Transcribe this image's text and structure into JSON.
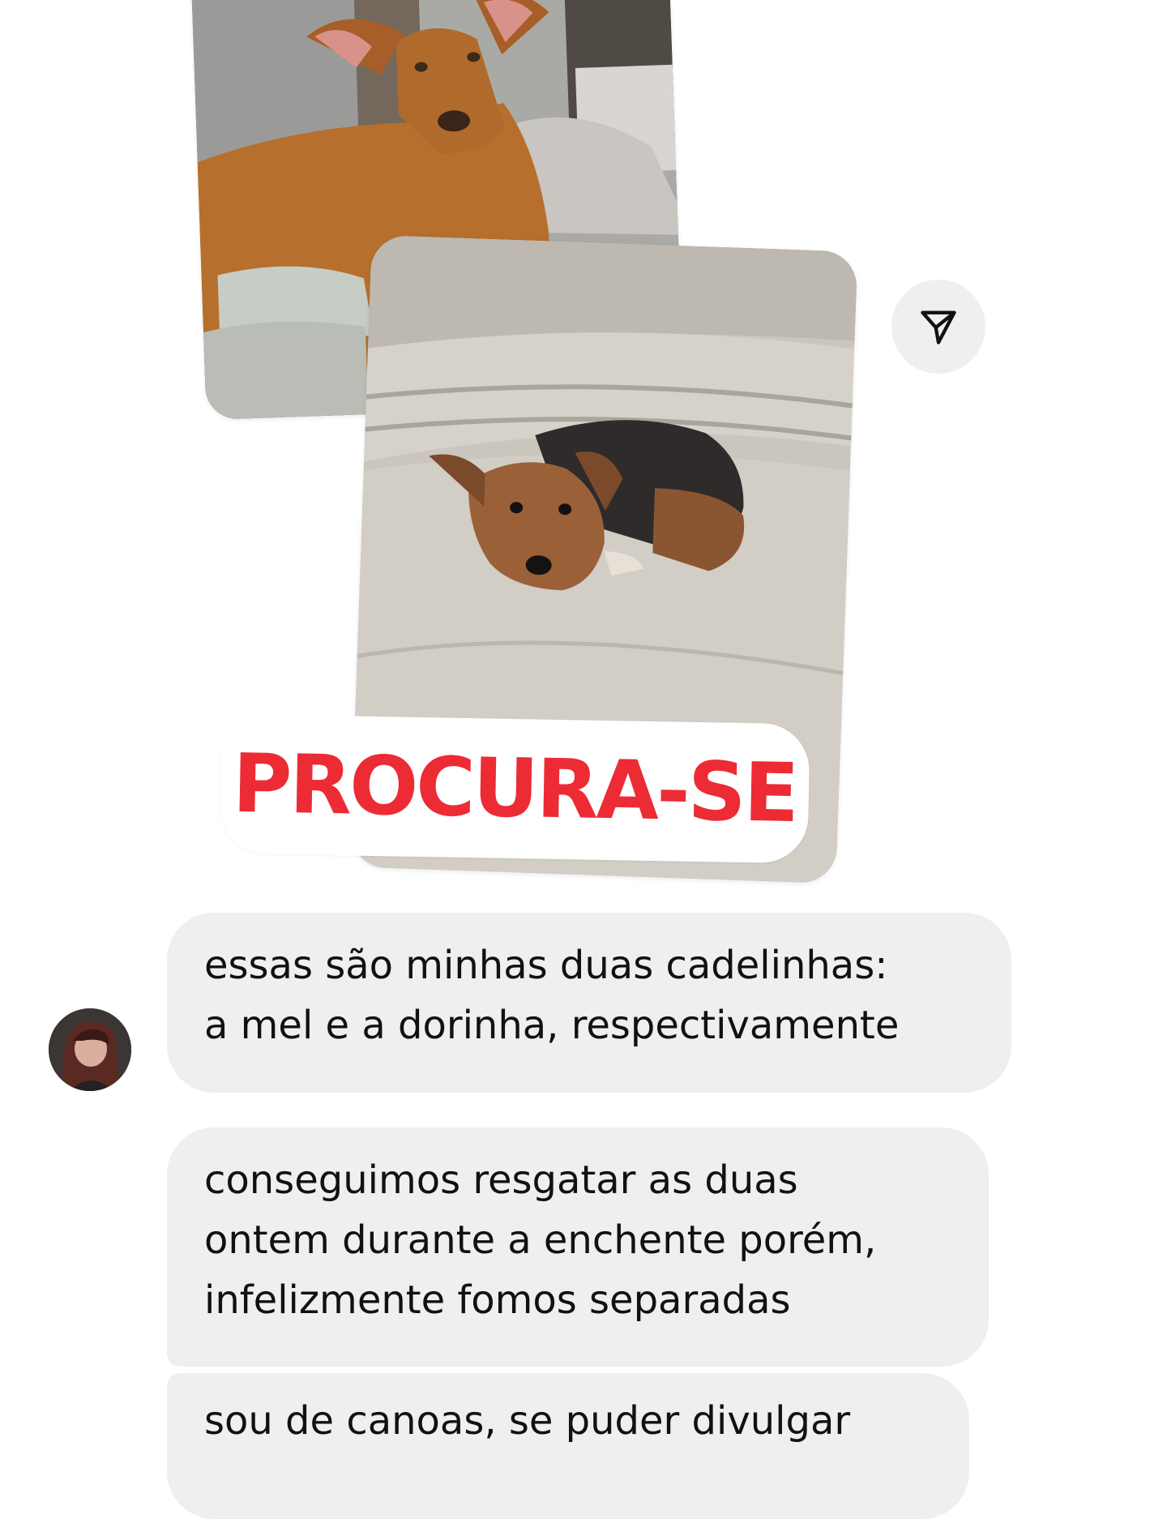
{
  "conversation": {
    "photos": [
      {
        "subject": "brown dog sitting on bed",
        "name": "mel"
      },
      {
        "subject": "black and tan dog lying on beige sofa",
        "name": "dorinha"
      }
    ],
    "sticker_text": "PROCURA-SE",
    "share_icon": "paper-plane-icon",
    "avatar_icon": "user-avatar",
    "messages": [
      {
        "lines": [
          "essas são minhas duas cadelinhas:",
          "a mel e a dorinha, respectivamente"
        ]
      },
      {
        "lines": [
          "conseguimos resgatar as duas",
          "ontem durante a enchente porém,",
          "infelizmente fomos separadas"
        ]
      },
      {
        "lines": [
          "sou de canoas, se puder divulgar"
        ]
      }
    ]
  },
  "colors": {
    "sticker_red": "#ec2b35",
    "bubble_bg": "#efefef",
    "text": "#111111",
    "share_bg": "#efefef"
  }
}
